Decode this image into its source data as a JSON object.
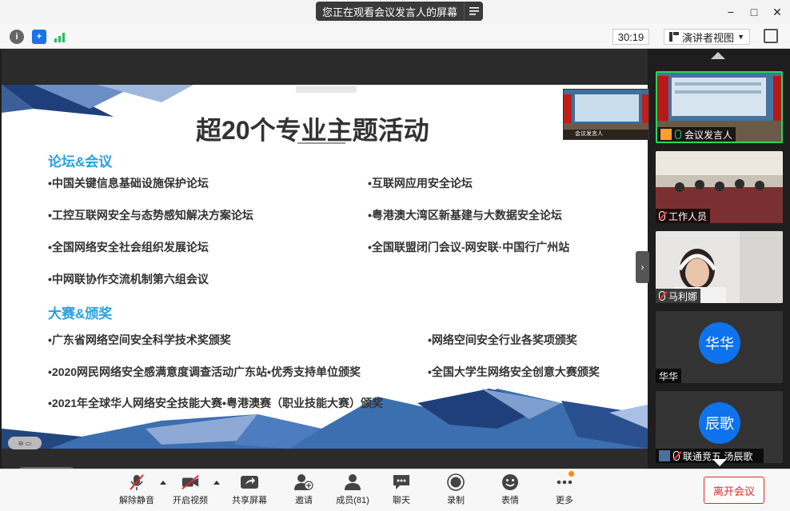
{
  "titlebar": {
    "share_banner": "您正在观看会议发言人的屏幕",
    "menu_icon": "list-menu-icon",
    "minimize": "−",
    "maximize": "□",
    "close": "✕"
  },
  "toolbar": {
    "timer": "30:19",
    "view_label": "演讲者视图",
    "icons": [
      "info-icon",
      "shield-icon",
      "signal-icon",
      "speaker-view-icon",
      "fullscreen-icon"
    ]
  },
  "slide": {
    "title": "超20个专业主题活动",
    "sections": [
      {
        "title": "论坛&会议",
        "items": [
          "•中国关键信息基础设施保护论坛",
          "•互联网应用安全论坛",
          "•工控互联网安全与态势感知解决方案论坛",
          "•粤港澳大湾区新基建与大数据安全论坛",
          "•全国网络安全社会组织发展论坛",
          "•全国联盟闭门会议-网安联·中国行广州站",
          "•中网联协作交流机制第六组会议"
        ]
      },
      {
        "title": "大赛&颁奖",
        "items": [
          "•广东省网络空间安全科学技术奖颁奖",
          "•网络空间安全行业各奖项颁奖",
          "•2020网民网络安全感满意度调查活动广东站•优秀支持单位颁奖",
          "•全国大学生网络安全创意大赛颁奖",
          "•2021年全球华人网络安全技能大赛•粤港澳赛（职业技能大赛）颁奖"
        ]
      }
    ],
    "thumbnail_label": "会议发言人"
  },
  "participants": [
    {
      "name": "会议发言人",
      "active": true,
      "muted": false,
      "kind": "video-stage"
    },
    {
      "name": "工作人员",
      "active": false,
      "muted": true,
      "kind": "video-room"
    },
    {
      "name": "马利娜",
      "active": false,
      "muted": true,
      "kind": "video-person"
    },
    {
      "name": "华华",
      "active": false,
      "muted": false,
      "kind": "avatar",
      "avatar": "华华"
    },
    {
      "name": "联通竞五 汤辰歌",
      "active": false,
      "muted": true,
      "kind": "avatar",
      "avatar": "辰歌"
    }
  ],
  "bottom": {
    "buttons": [
      {
        "label": "解除静音",
        "icon": "mic-muted-icon"
      },
      {
        "label": "开启视频",
        "icon": "video-off-icon"
      },
      {
        "label": "共享屏幕",
        "icon": "share-screen-icon"
      },
      {
        "label": "邀请",
        "icon": "invite-icon"
      },
      {
        "label": "成员(81)",
        "icon": "participants-icon"
      },
      {
        "label": "聊天",
        "icon": "chat-icon"
      },
      {
        "label": "录制",
        "icon": "record-icon"
      },
      {
        "label": "表情",
        "icon": "emoji-icon"
      },
      {
        "label": "更多",
        "icon": "more-icon"
      }
    ],
    "leave": "离开会议"
  },
  "colors": {
    "accent_blue": "#0e72ed",
    "section_blue": "#2aa0dc",
    "active_green": "#23d959",
    "leave_red": "#e02828"
  }
}
